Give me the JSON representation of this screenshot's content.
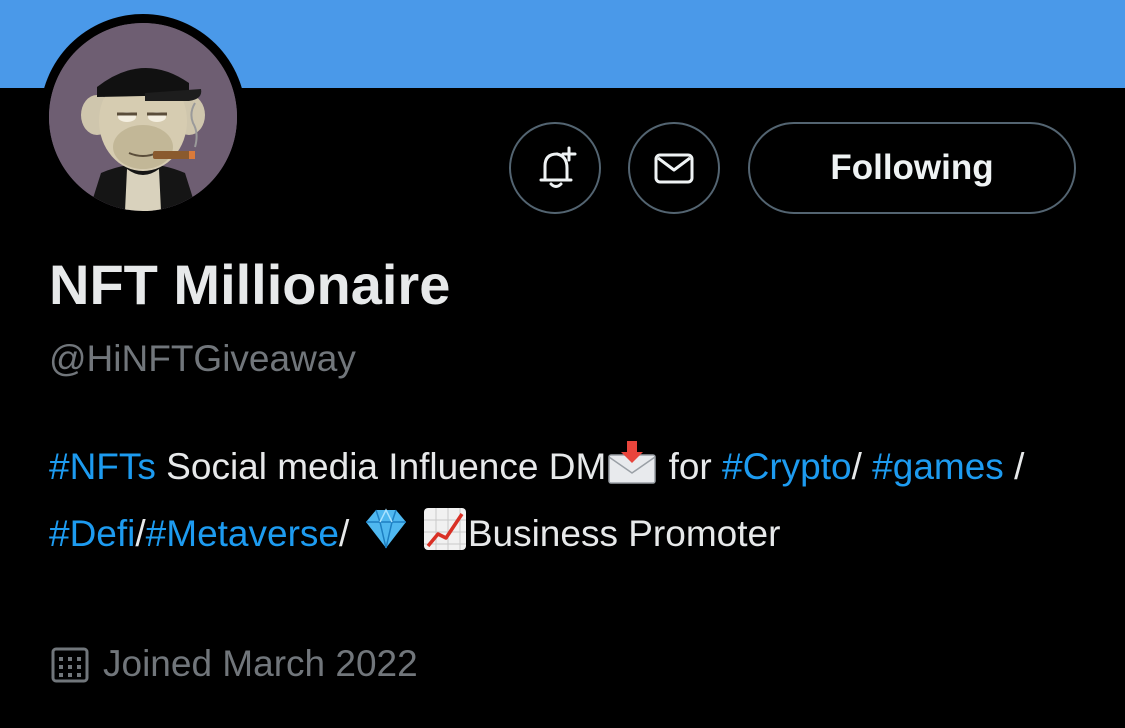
{
  "colors": {
    "banner": "#4a99e9",
    "background": "#000000",
    "hashtag": "#1d9bf0",
    "muted": "#71767b",
    "border": "#536471"
  },
  "actions": {
    "notify_icon": "bell-plus-icon",
    "message_icon": "envelope-icon",
    "following_label": "Following"
  },
  "profile": {
    "display_name": "NFT Millionaire",
    "handle": "@HiNFTGiveaway",
    "bio": {
      "tag_nfts": "#NFTs",
      "text1": " Social media Influence DM",
      "emoji_mail": "envelope-with-arrow-emoji",
      "text2": " for ",
      "tag_crypto": "#Crypto",
      "text3": "/ ",
      "tag_games": "#games",
      "text4": " / ",
      "tag_defi": "#Defi",
      "text5": "/",
      "tag_metaverse": "#Metaverse",
      "text6": "/ ",
      "emoji_gem": "gem-emoji",
      "emoji_chart": "chart-increasing-emoji",
      "text7": "Business Promoter"
    },
    "joined_icon": "calendar-icon",
    "joined": "Joined March 2022"
  }
}
